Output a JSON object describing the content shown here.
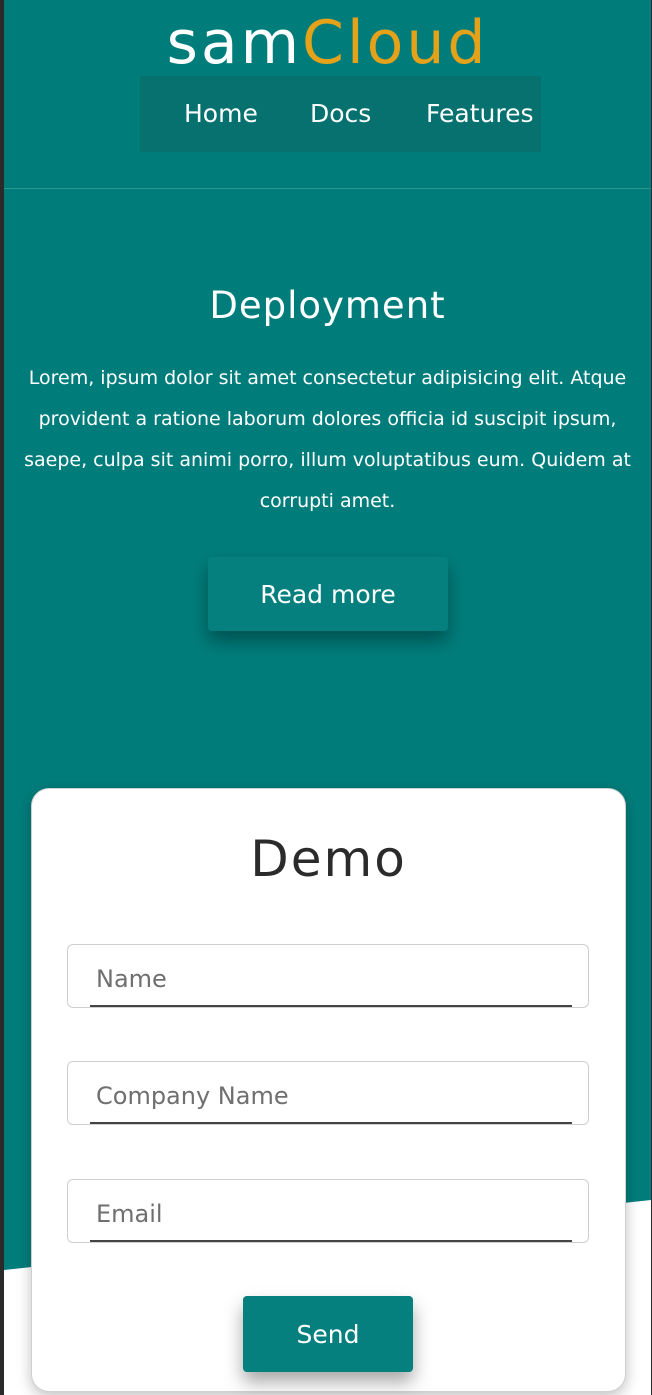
{
  "header": {
    "logo_part1": "sam",
    "logo_part2": "Cloud",
    "nav": {
      "home": "Home",
      "docs": "Docs",
      "features": "Features"
    }
  },
  "hero": {
    "title": "Deployment",
    "text": "Lorem, ipsum dolor sit amet consectetur adipisicing elit. Atque provident a ratione laborum dolores officia id suscipit ipsum, saepe, culpa sit animi porro, illum voluptatibus eum. Quidem at corrupti amet.",
    "button_label": "Read more"
  },
  "demo_form": {
    "title": "Demo",
    "name_placeholder": "Name",
    "company_placeholder": "Company Name",
    "email_placeholder": "Email",
    "send_label": "Send"
  },
  "colors": {
    "teal": "#007d7b",
    "nav_bg": "#06716f",
    "accent": "#e3a21a",
    "button": "#06807e"
  }
}
